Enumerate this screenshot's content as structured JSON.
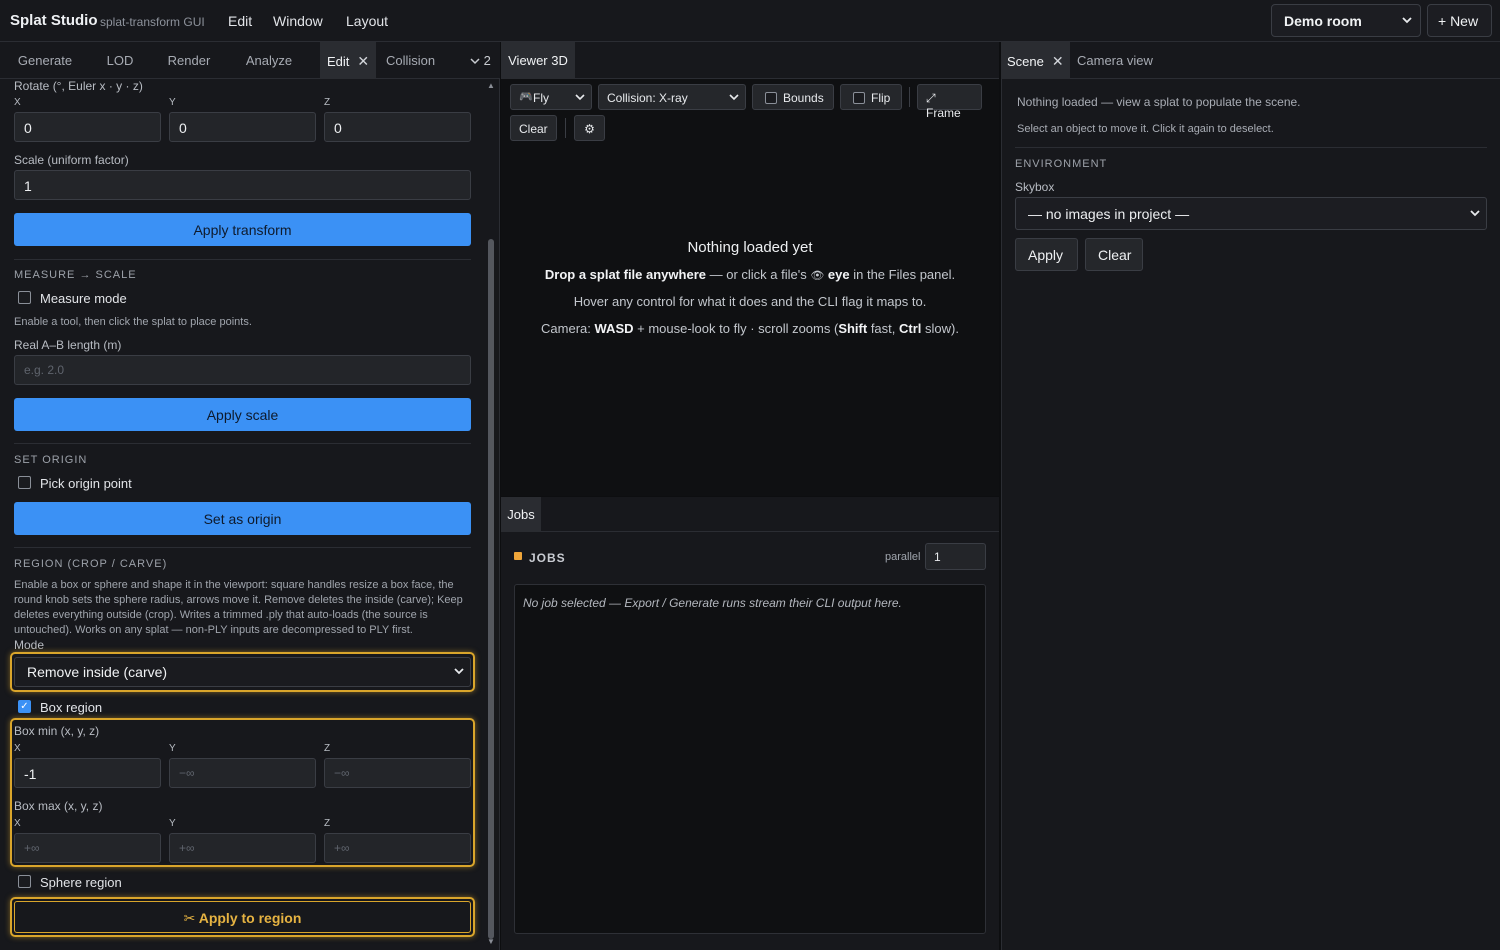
{
  "app": {
    "name": "Splat Studio",
    "subtitle": "splat-transform GUI",
    "menu": [
      "Edit",
      "Window",
      "Layout"
    ],
    "project": "Demo room",
    "new_label": "+ New"
  },
  "left_tabs": {
    "items": [
      "Generate",
      "LOD",
      "Render",
      "Analyze",
      "Edit",
      "Collision"
    ],
    "active": "Edit",
    "overflow_count": "2"
  },
  "edit": {
    "rotate_label": "Rotate (°, Euler x · y · z)",
    "axes": [
      "X",
      "Y",
      "Z"
    ],
    "rotate_values": [
      "0",
      "0",
      "0"
    ],
    "scale_label": "Scale (uniform factor)",
    "scale_value": "1",
    "apply_transform": "Apply transform",
    "measure": {
      "title": "MEASURE → SCALE",
      "mode_label": "Measure mode",
      "mode_checked": false,
      "hint": "Enable a tool, then click the splat to place points.",
      "length_label": "Real A–B length (m)",
      "length_placeholder": "e.g. 2.0",
      "apply_label": "Apply scale"
    },
    "origin": {
      "title": "SET ORIGIN",
      "pick_label": "Pick origin point",
      "pick_checked": false,
      "set_label": "Set as origin"
    },
    "region": {
      "title": "REGION (CROP / CARVE)",
      "hint_lines": [
        "Enable a box or sphere and shape it in the viewport: square handles resize a box face, the",
        "round knob sets the sphere radius, arrows move it. Remove deletes the inside (carve); Keep",
        "deletes everything outside (crop). Writes a trimmed .ply that auto-loads (the source is",
        "untouched). Works on any splat — non-PLY inputs are decompressed to PLY first."
      ],
      "mode_label": "Mode",
      "mode_value": "Remove inside (carve)",
      "box_label": "Box region",
      "box_checked": true,
      "box_min_label": "Box min (x, y, z)",
      "box_min": [
        "-1",
        "−∞",
        "−∞"
      ],
      "box_max_label": "Box max (x, y, z)",
      "box_max": [
        "+∞",
        "+∞",
        "+∞"
      ],
      "sphere_label": "Sphere region",
      "sphere_checked": false,
      "apply_label": "Apply to region"
    }
  },
  "viewer": {
    "tab": "Viewer 3D",
    "fly_label": "Fly",
    "collision_label": "Collision: X-ray",
    "bounds_label": "Bounds",
    "flip_label": "Flip",
    "frame_label": "⤢ Frame",
    "clear_label": "Clear",
    "settings_icon": "gear-icon",
    "empty_title": "Nothing loaded yet",
    "empty_line1": {
      "b1": "Drop a splat file anywhere",
      "t1": " — or click a file's ",
      "icon": "👁",
      "b2": " eye",
      "t2": " in the Files panel."
    },
    "empty_line2": "Hover any control for what it does and the CLI flag it maps to.",
    "empty_line3": {
      "t1": "Camera: ",
      "b1": "WASD",
      "t2": " + mouse-look to fly · scroll zooms (",
      "b2": "Shift",
      "t3": " fast, ",
      "b3": "Ctrl",
      "t4": " slow)."
    }
  },
  "jobs": {
    "tab": "Jobs",
    "title": "JOBS",
    "parallel_label": "parallel",
    "parallel_value": "1",
    "output_placeholder": "No job selected — Export / Generate runs stream their CLI output here."
  },
  "scene": {
    "tabs": [
      "Scene",
      "Camera view"
    ],
    "active": "Scene",
    "nothing_loaded": "Nothing loaded — view a splat to populate the scene.",
    "select_hint": "Select an object to move it. Click it again to deselect.",
    "env_title": "ENVIRONMENT",
    "skybox_label": "Skybox",
    "skybox_value": "— no images in project —",
    "apply_label": "Apply",
    "clear_label": "Clear"
  },
  "colors": {
    "accent": "#3b91f5",
    "highlight": "#d9a52b",
    "jobs_dot": "#f0a63a"
  }
}
